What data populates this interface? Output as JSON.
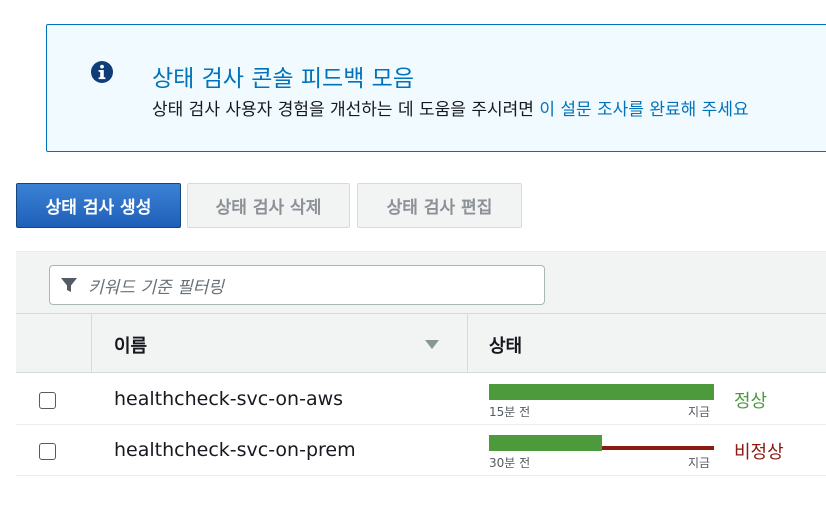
{
  "banner": {
    "title": "상태 검사 콘솔 피드백 모음",
    "body_text": "상태 검사 사용자 경험을 개선하는 데 도움을 주시려면 ",
    "link_text": "이 설문 조사를 완료해 주세요"
  },
  "toolbar": {
    "create_label": "상태 검사 생성",
    "delete_label": "상태 검사 삭제",
    "edit_label": "상태 검사 편집"
  },
  "filter": {
    "placeholder": "키워드 기준 필터링"
  },
  "table": {
    "columns": [
      "이름",
      "상태"
    ],
    "rows": [
      {
        "name": "healthcheck-svc-on-aws",
        "timeline_start": "15분 전",
        "timeline_end": "지금",
        "healthy_fraction": 1.0,
        "status": "정상"
      },
      {
        "name": "healthcheck-svc-on-prem",
        "timeline_start": "30분 전",
        "timeline_end": "지금",
        "healthy_fraction": 0.5,
        "status": "비정상"
      }
    ]
  },
  "colors": {
    "primary": "#1f5fb8",
    "link": "#0073bb",
    "healthy": "#4c9a3c",
    "unhealthy": "#8b1a10"
  }
}
